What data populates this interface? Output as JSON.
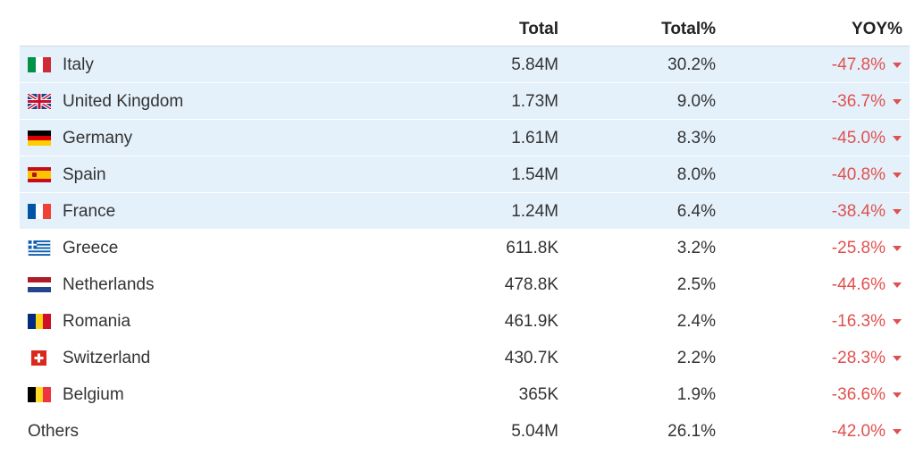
{
  "header": {
    "total": "Total",
    "total_pct": "Total%",
    "yoy": "YOY%"
  },
  "rows": [
    {
      "country": "Italy",
      "total": "5.84M",
      "pct": "30.2%",
      "yoy": "-47.8%"
    },
    {
      "country": "United Kingdom",
      "total": "1.73M",
      "pct": "9.0%",
      "yoy": "-36.7%"
    },
    {
      "country": "Germany",
      "total": "1.61M",
      "pct": "8.3%",
      "yoy": "-45.0%"
    },
    {
      "country": "Spain",
      "total": "1.54M",
      "pct": "8.0%",
      "yoy": "-40.8%"
    },
    {
      "country": "France",
      "total": "1.24M",
      "pct": "6.4%",
      "yoy": "-38.4%"
    },
    {
      "country": "Greece",
      "total": "611.8K",
      "pct": "3.2%",
      "yoy": "-25.8%"
    },
    {
      "country": "Netherlands",
      "total": "478.8K",
      "pct": "2.5%",
      "yoy": "-44.6%"
    },
    {
      "country": "Romania",
      "total": "461.9K",
      "pct": "2.4%",
      "yoy": "-16.3%"
    },
    {
      "country": "Switzerland",
      "total": "430.7K",
      "pct": "2.2%",
      "yoy": "-28.3%"
    },
    {
      "country": "Belgium",
      "total": "365K",
      "pct": "1.9%",
      "yoy": "-36.6%"
    },
    {
      "country": "Others",
      "total": "5.04M",
      "pct": "26.1%",
      "yoy": "-42.0%"
    }
  ],
  "colors": {
    "highlight": "#e4f1fb",
    "negative": "#e0504f"
  }
}
